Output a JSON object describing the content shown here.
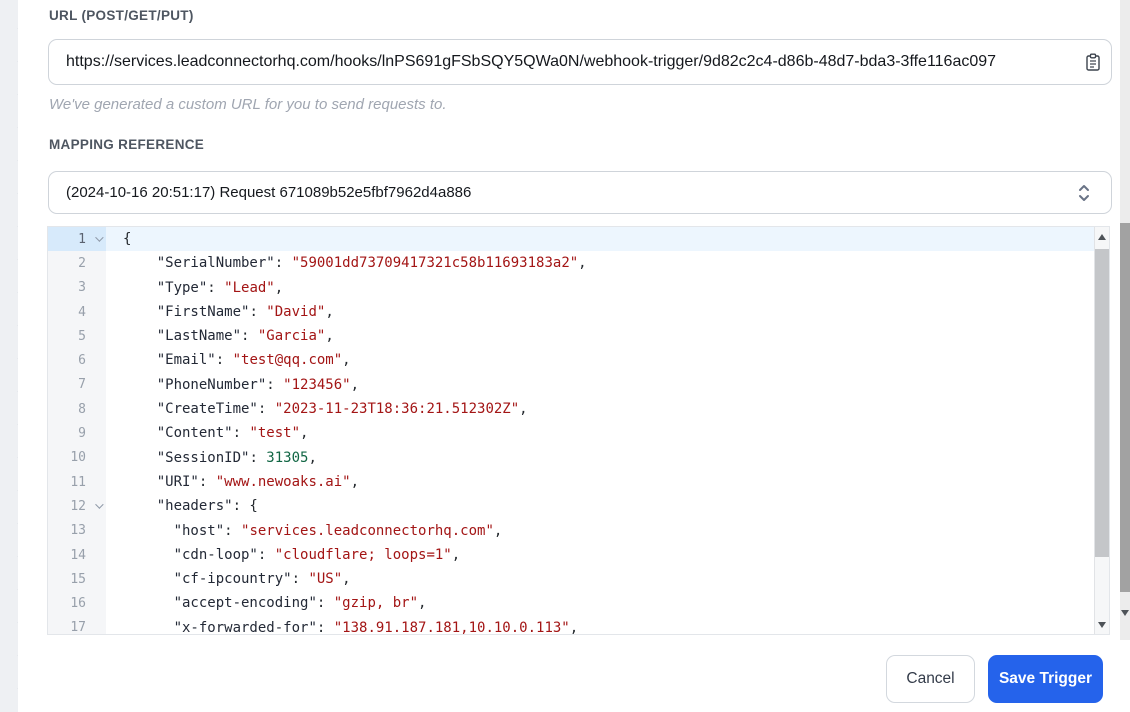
{
  "url_section": {
    "label": "URL (POST/GET/PUT)",
    "value": "https://services.leadconnectorhq.com/hooks/lnPS691gFSbSQY5QWa0N/webhook-trigger/9d82c2c4-d86b-48d7-bda3-3ffe116ac097",
    "helper": "We've generated a custom URL for you to send requests to.",
    "copy_icon": "clipboard-icon"
  },
  "mapping_section": {
    "label": "MAPPING REFERENCE",
    "selected_option": "(2024-10-16 20:51:17) Request 671089b52e5fbf7962d4a886",
    "caret_icon": "up-down-chevron-icon"
  },
  "editor": {
    "language": "json",
    "active_line": 1,
    "lines": [
      {
        "n": 1,
        "fold": true,
        "active": true,
        "tokens": [
          [
            "p",
            "{"
          ]
        ]
      },
      {
        "n": 2,
        "tokens": [
          [
            "p",
            "    "
          ],
          [
            "k",
            "\"SerialNumber\""
          ],
          [
            "p",
            ": "
          ],
          [
            "s",
            "\"59001dd73709417321c58b11693183a2\""
          ],
          [
            "p",
            ","
          ]
        ]
      },
      {
        "n": 3,
        "tokens": [
          [
            "p",
            "    "
          ],
          [
            "k",
            "\"Type\""
          ],
          [
            "p",
            ": "
          ],
          [
            "s",
            "\"Lead\""
          ],
          [
            "p",
            ","
          ]
        ]
      },
      {
        "n": 4,
        "tokens": [
          [
            "p",
            "    "
          ],
          [
            "k",
            "\"FirstName\""
          ],
          [
            "p",
            ": "
          ],
          [
            "s",
            "\"David\""
          ],
          [
            "p",
            ","
          ]
        ]
      },
      {
        "n": 5,
        "tokens": [
          [
            "p",
            "    "
          ],
          [
            "k",
            "\"LastName\""
          ],
          [
            "p",
            ": "
          ],
          [
            "s",
            "\"Garcia\""
          ],
          [
            "p",
            ","
          ]
        ]
      },
      {
        "n": 6,
        "tokens": [
          [
            "p",
            "    "
          ],
          [
            "k",
            "\"Email\""
          ],
          [
            "p",
            ": "
          ],
          [
            "s",
            "\"test@qq.com\""
          ],
          [
            "p",
            ","
          ]
        ]
      },
      {
        "n": 7,
        "tokens": [
          [
            "p",
            "    "
          ],
          [
            "k",
            "\"PhoneNumber\""
          ],
          [
            "p",
            ": "
          ],
          [
            "s",
            "\"123456\""
          ],
          [
            "p",
            ","
          ]
        ]
      },
      {
        "n": 8,
        "tokens": [
          [
            "p",
            "    "
          ],
          [
            "k",
            "\"CreateTime\""
          ],
          [
            "p",
            ": "
          ],
          [
            "s",
            "\"2023-11-23T18:36:21.512302Z\""
          ],
          [
            "p",
            ","
          ]
        ]
      },
      {
        "n": 9,
        "tokens": [
          [
            "p",
            "    "
          ],
          [
            "k",
            "\"Content\""
          ],
          [
            "p",
            ": "
          ],
          [
            "s",
            "\"test\""
          ],
          [
            "p",
            ","
          ]
        ]
      },
      {
        "n": 10,
        "tokens": [
          [
            "p",
            "    "
          ],
          [
            "k",
            "\"SessionID\""
          ],
          [
            "p",
            ": "
          ],
          [
            "n",
            "31305"
          ],
          [
            "p",
            ","
          ]
        ]
      },
      {
        "n": 11,
        "tokens": [
          [
            "p",
            "    "
          ],
          [
            "k",
            "\"URI\""
          ],
          [
            "p",
            ": "
          ],
          [
            "s",
            "\"www.newoaks.ai\""
          ],
          [
            "p",
            ","
          ]
        ]
      },
      {
        "n": 12,
        "fold": true,
        "tokens": [
          [
            "p",
            "    "
          ],
          [
            "k",
            "\"headers\""
          ],
          [
            "p",
            ": {"
          ]
        ]
      },
      {
        "n": 13,
        "tokens": [
          [
            "p",
            "      "
          ],
          [
            "k",
            "\"host\""
          ],
          [
            "p",
            ": "
          ],
          [
            "s",
            "\"services.leadconnectorhq.com\""
          ],
          [
            "p",
            ","
          ]
        ]
      },
      {
        "n": 14,
        "tokens": [
          [
            "p",
            "      "
          ],
          [
            "k",
            "\"cdn-loop\""
          ],
          [
            "p",
            ": "
          ],
          [
            "s",
            "\"cloudflare; loops=1\""
          ],
          [
            "p",
            ","
          ]
        ]
      },
      {
        "n": 15,
        "tokens": [
          [
            "p",
            "      "
          ],
          [
            "k",
            "\"cf-ipcountry\""
          ],
          [
            "p",
            ": "
          ],
          [
            "s",
            "\"US\""
          ],
          [
            "p",
            ","
          ]
        ]
      },
      {
        "n": 16,
        "tokens": [
          [
            "p",
            "      "
          ],
          [
            "k",
            "\"accept-encoding\""
          ],
          [
            "p",
            ": "
          ],
          [
            "s",
            "\"gzip, br\""
          ],
          [
            "p",
            ","
          ]
        ]
      },
      {
        "n": 17,
        "tokens": [
          [
            "p",
            "      "
          ],
          [
            "k",
            "\"x-forwarded-for\""
          ],
          [
            "p",
            ": "
          ],
          [
            "s",
            "\"138.91.187.181,10.10.0.113\""
          ],
          [
            "p",
            ","
          ]
        ]
      }
    ]
  },
  "footer": {
    "cancel_label": "Cancel",
    "save_label": "Save Trigger"
  },
  "colors": {
    "accent_blue": "#2563eb",
    "string_red": "#a31515",
    "number_green": "#116644",
    "key_dark": "#232936",
    "line_number_gray": "#98a0ab",
    "active_line_blue": "#edf6fe"
  }
}
